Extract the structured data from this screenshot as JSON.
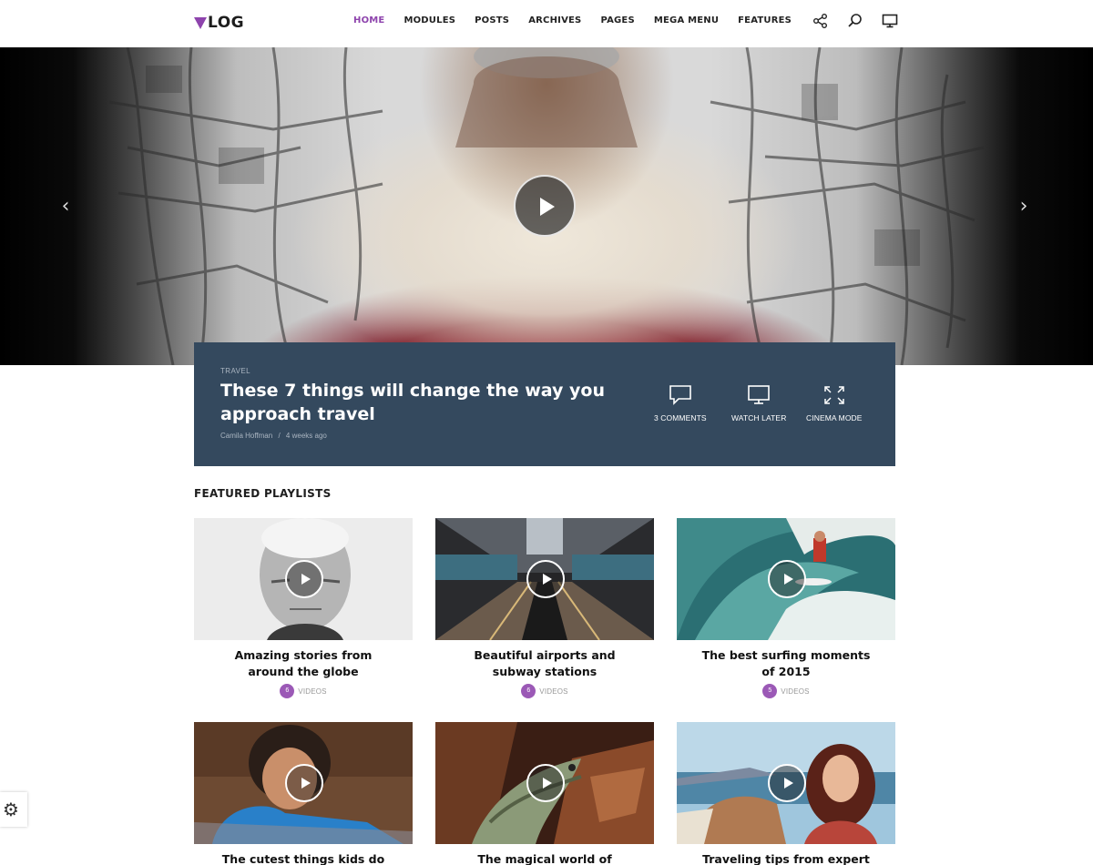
{
  "header": {
    "logo_text": "LOG",
    "nav": [
      "HOME",
      "MODULES",
      "POSTS",
      "ARCHIVES",
      "PAGES",
      "MEGA MENU",
      "FEATURES"
    ],
    "active_nav": "HOME",
    "icons": [
      "share-icon",
      "search-icon",
      "monitor-icon"
    ]
  },
  "hero": {
    "prev_glyph": "‹",
    "next_glyph": "›"
  },
  "featured": {
    "category": "TRAVEL",
    "title": "These 7 things will change the way you approach travel",
    "author": "Camila Hoffman",
    "separator": "/",
    "time": "4 weeks ago",
    "actions": {
      "comments": "3 COMMENTS",
      "watch_later": "WATCH LATER",
      "cinema_mode": "CINEMA MODE"
    }
  },
  "playlists": {
    "heading": "FEATURED PLAYLISTS",
    "items": [
      {
        "title_line1": "Amazing stories from",
        "title_line2": "around the globe",
        "count": "6",
        "label": "VIDEOS"
      },
      {
        "title_line1": "Beautiful airports and",
        "title_line2": "subway stations",
        "count": "6",
        "label": "VIDEOS"
      },
      {
        "title_line1": "The best surfing moments",
        "title_line2": "of 2015",
        "count": "5",
        "label": "VIDEOS"
      },
      {
        "title_line1": "The cutest things kids do"
      },
      {
        "title_line1": "The magical world of"
      },
      {
        "title_line1": "Traveling tips from expert"
      }
    ]
  },
  "colors": {
    "accent": "#8e44ad",
    "panel_bg": "#34495e",
    "count_badge": "#9b59b6"
  },
  "settings_icon": "gear-icon"
}
